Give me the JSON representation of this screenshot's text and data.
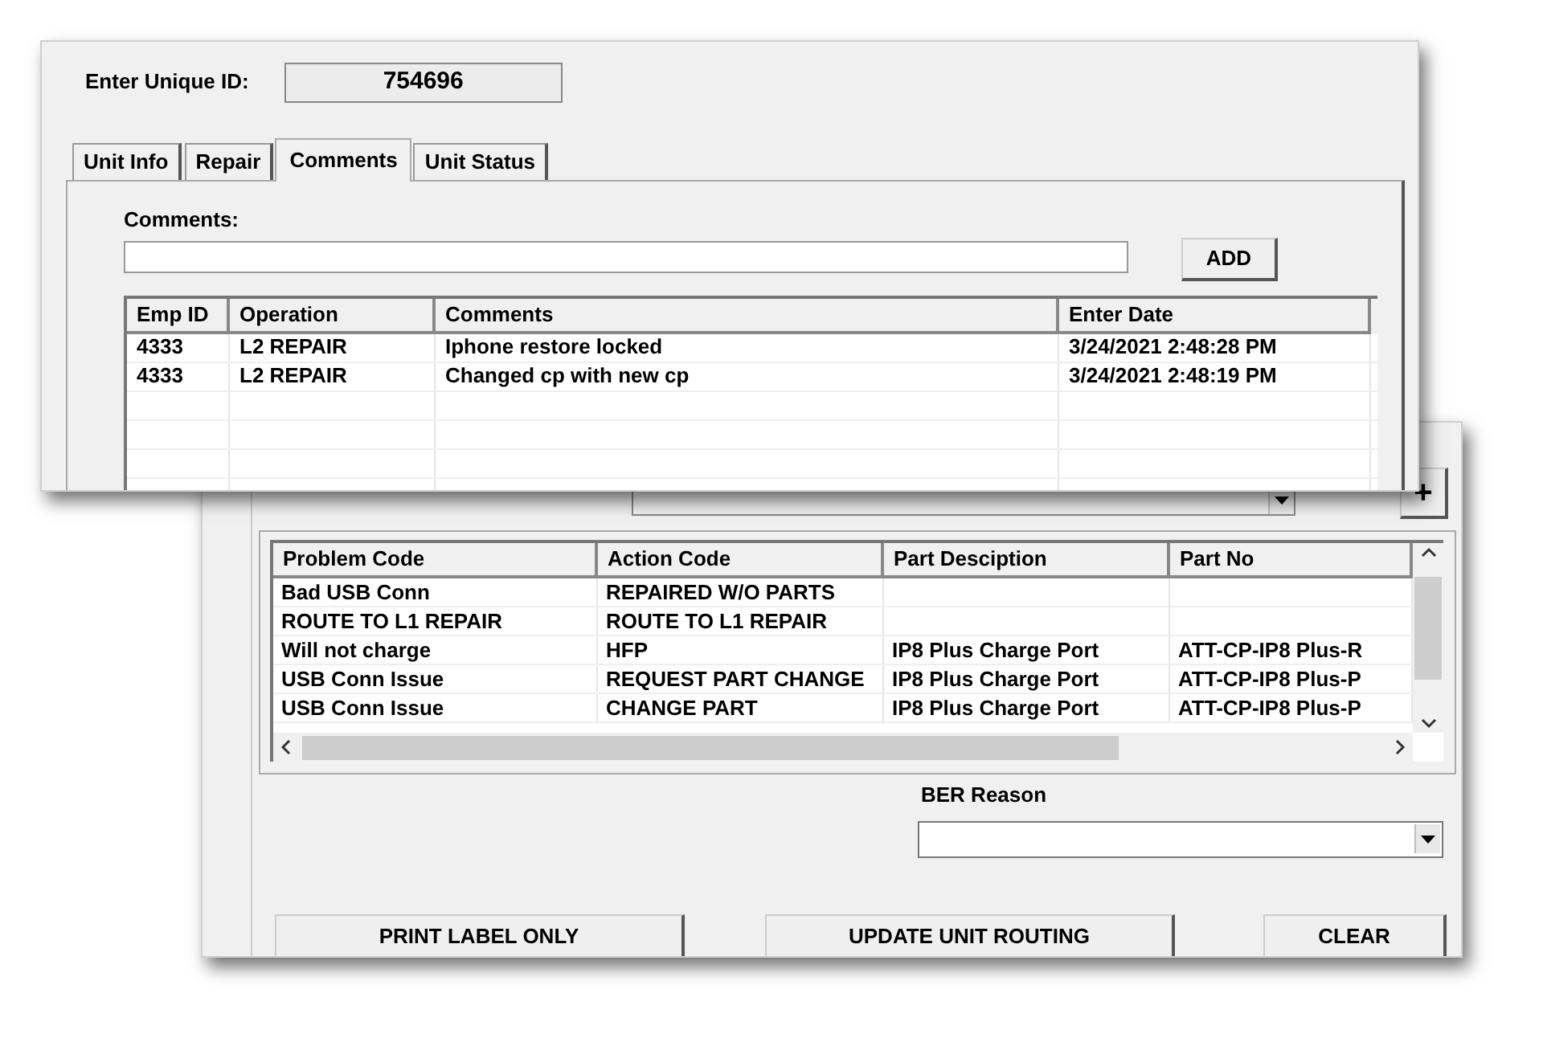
{
  "top_window": {
    "unique_id": {
      "label": "Enter Unique ID:",
      "value": "754696"
    },
    "tabs": [
      {
        "label": "Unit Info",
        "selected": false
      },
      {
        "label": "Repair",
        "selected": false
      },
      {
        "label": "Comments",
        "selected": true
      },
      {
        "label": "Unit Status",
        "selected": false
      }
    ],
    "comments": {
      "label": "Comments:",
      "add_button": "ADD"
    },
    "comments_table": {
      "columns": [
        "Emp ID",
        "Operation",
        "Comments",
        "Enter Date"
      ],
      "rows": [
        [
          "4333",
          "L2 REPAIR",
          "Iphone restore locked",
          "3/24/2021 2:48:28 PM"
        ],
        [
          "4333",
          "L2 REPAIR",
          "Changed cp with new cp",
          "3/24/2021 2:48:19 PM"
        ]
      ]
    }
  },
  "bottom_window": {
    "plus_button": "+",
    "parts_table": {
      "columns": [
        "Problem Code",
        "Action Code",
        "Part Desciption",
        "Part No"
      ],
      "rows": [
        [
          "Bad USB Conn",
          "REPAIRED W/O PARTS"
        ],
        [
          "ROUTE TO L1 REPAIR",
          "ROUTE TO L1 REPAIR"
        ],
        [
          "Will not charge",
          "HFP",
          "IP8 Plus Charge Port",
          "ATT-CP-IP8 Plus-R"
        ],
        [
          "USB Conn Issue",
          "REQUEST PART CHANGE",
          "IP8 Plus Charge Port",
          "ATT-CP-IP8 Plus-P"
        ],
        [
          "USB Conn Issue",
          "CHANGE PART",
          "IP8 Plus Charge Port",
          "ATT-CP-IP8 Plus-P"
        ]
      ]
    },
    "ber_reason": {
      "label": "BER Reason"
    },
    "buttons": [
      "PRINT LABEL ONLY",
      "UPDATE UNIT ROUTING",
      "CLEAR"
    ]
  }
}
